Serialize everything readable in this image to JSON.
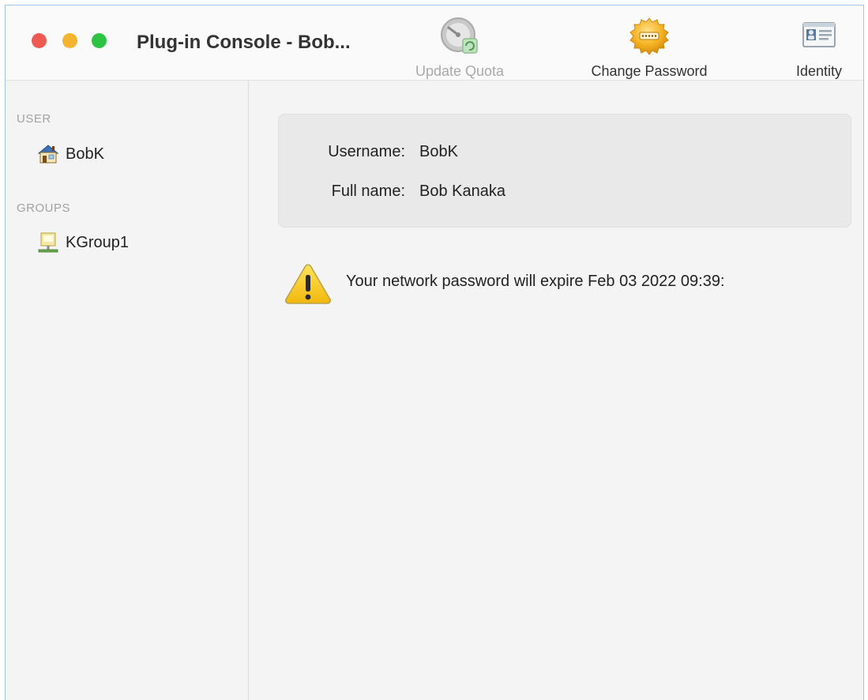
{
  "window": {
    "title": "Plug-in Console - Bob..."
  },
  "toolbar": {
    "update_quota": {
      "label": "Update Quota",
      "enabled": false,
      "icon": "quota-gauge-icon"
    },
    "change_password": {
      "label": "Change Password",
      "enabled": true,
      "icon": "password-seal-icon"
    },
    "identity": {
      "label": "Identity",
      "enabled": true,
      "icon": "id-card-icon"
    }
  },
  "sidebar": {
    "user_header": "USER",
    "user": {
      "label": "BobK",
      "icon": "home-user-icon"
    },
    "groups_header": "GROUPS",
    "groups": [
      {
        "label": "KGroup1",
        "icon": "group-folder-icon"
      }
    ]
  },
  "details": {
    "username_label": "Username:",
    "username": "BobK",
    "fullname_label": "Full name:",
    "fullname": "Bob Kanaka"
  },
  "warning": {
    "icon": "warning-triangle-icon",
    "text": "Your network password will expire Feb 03 2022 09:39:"
  },
  "colors": {
    "close": "#ee5a52",
    "minimize": "#f5b430",
    "zoom": "#2dc443",
    "window_border": "#9cc6ea"
  }
}
